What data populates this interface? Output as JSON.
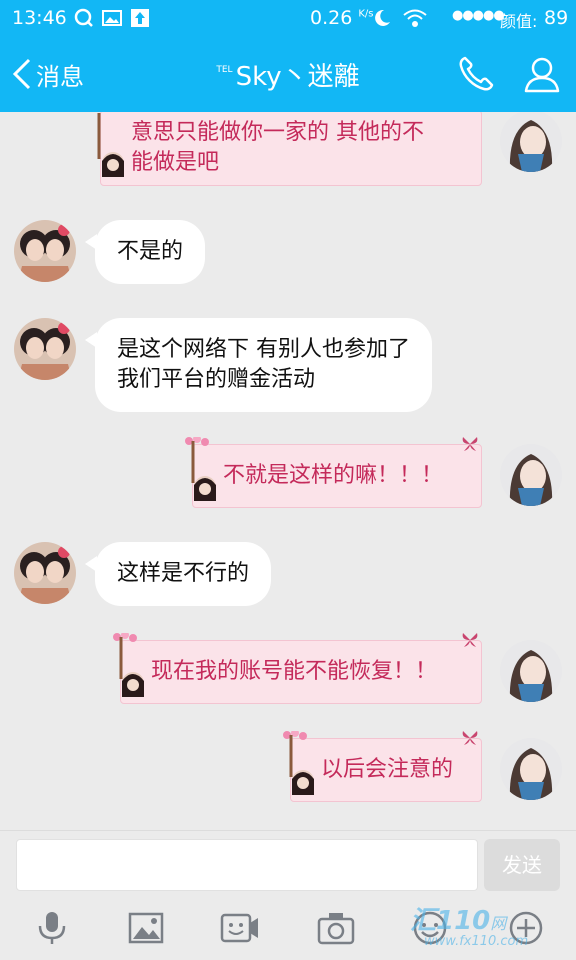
{
  "status_bar": {
    "time": "13:46",
    "net_speed": "0.26",
    "net_speed_unit": "K/s",
    "signal": "●●●●●",
    "carrier": "颜值:",
    "battery": "89"
  },
  "header": {
    "back_label": "消息",
    "title_prefix": "TEL",
    "title": "Sky丶迷離"
  },
  "messages": [
    {
      "side": "right",
      "lines": [
        "意思只能做你一家的 其他的不",
        "能做是吧"
      ]
    },
    {
      "side": "left",
      "lines": [
        "不是的"
      ]
    },
    {
      "side": "left",
      "lines": [
        "是这个网络下 有别人也参加了",
        "我们平台的赠金活动"
      ]
    },
    {
      "side": "right",
      "lines": [
        "不就是这样的嘛！！！"
      ]
    },
    {
      "side": "left",
      "lines": [
        "这样是不行的"
      ]
    },
    {
      "side": "right",
      "lines": [
        "现在我的账号能不能恢复！！"
      ]
    },
    {
      "side": "right",
      "lines": [
        "以后会注意的"
      ]
    }
  ],
  "input": {
    "value": "",
    "send_label": "发送"
  },
  "toolbar": {
    "icons": [
      "microphone-icon",
      "image-icon",
      "sticker-icon",
      "camera-icon",
      "emoji-icon",
      "plus-icon"
    ]
  },
  "watermark": {
    "text": "汇110",
    "suffix": "网",
    "url": "www.fx110.com"
  },
  "colors": {
    "accent": "#12b7f5",
    "right_bubble_bg": "#fbe3e9",
    "right_bubble_text": "#c42a5a"
  }
}
